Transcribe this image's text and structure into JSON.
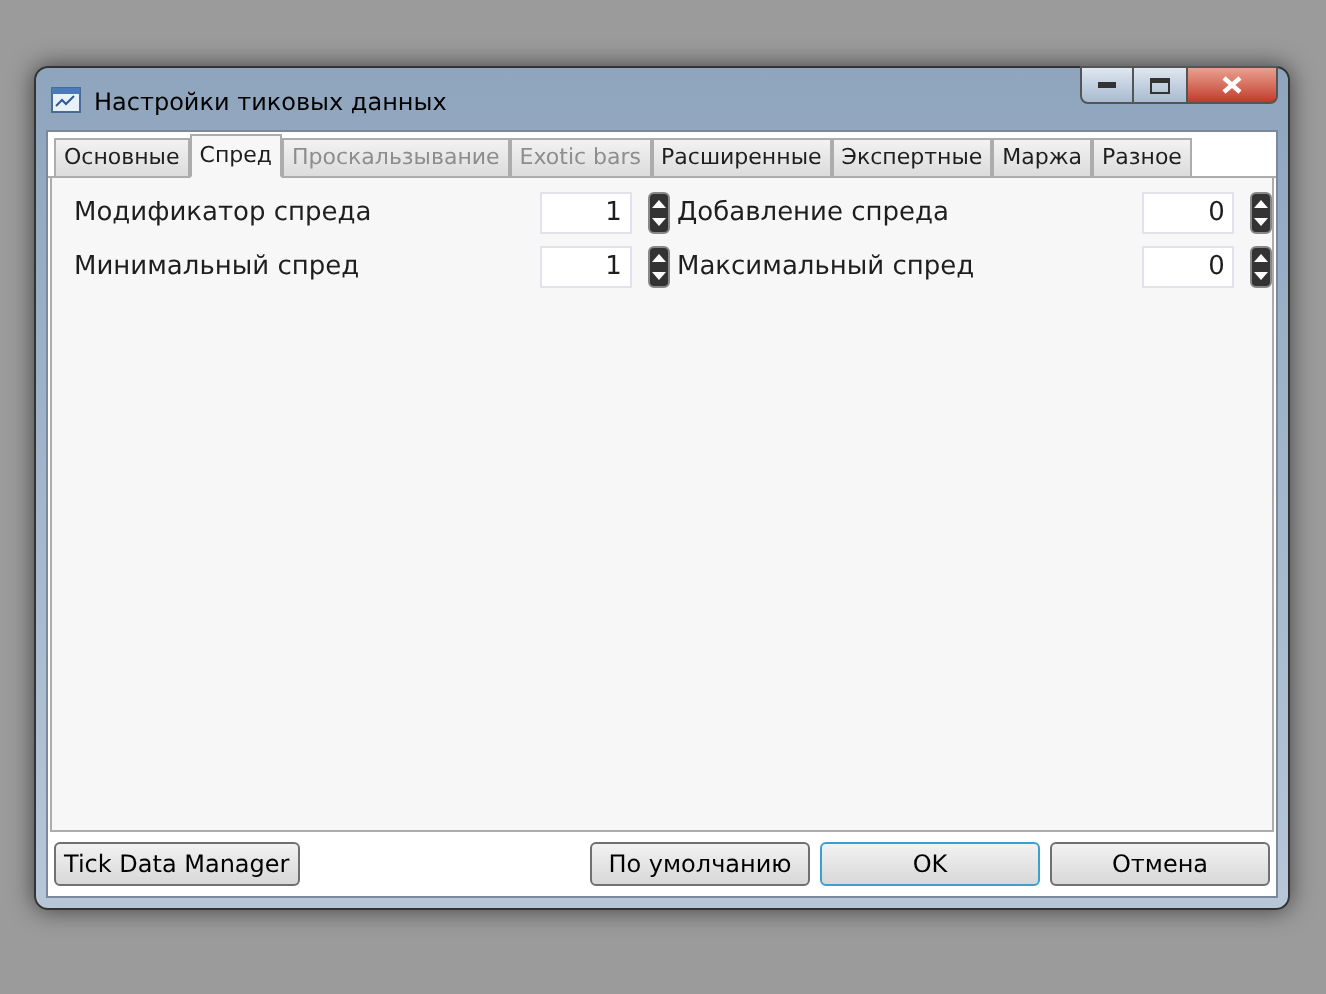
{
  "window": {
    "title": "Настройки тиковых данных"
  },
  "tabs": [
    {
      "label": "Основные",
      "selected": false,
      "disabled": false
    },
    {
      "label": "Спред",
      "selected": true,
      "disabled": false
    },
    {
      "label": "Проскальзывание",
      "selected": false,
      "disabled": true
    },
    {
      "label": "Exotic bars",
      "selected": false,
      "disabled": true
    },
    {
      "label": "Расширенные",
      "selected": false,
      "disabled": false
    },
    {
      "label": "Экспертные",
      "selected": false,
      "disabled": false
    },
    {
      "label": "Маржа",
      "selected": false,
      "disabled": false
    },
    {
      "label": "Разное",
      "selected": false,
      "disabled": false
    }
  ],
  "fields": [
    {
      "label": "Модификатор спреда",
      "value": "1"
    },
    {
      "label": "Добавление спреда",
      "value": "0"
    },
    {
      "label": "Минимальный спред",
      "value": "1"
    },
    {
      "label": "Максимальный спред",
      "value": "0"
    }
  ],
  "buttons": [
    {
      "label": "Tick Data Manager",
      "focused": false
    },
    {
      "label": "По умолчанию",
      "focused": false
    },
    {
      "label": "OK",
      "focused": true
    },
    {
      "label": "Отмена",
      "focused": false
    }
  ]
}
